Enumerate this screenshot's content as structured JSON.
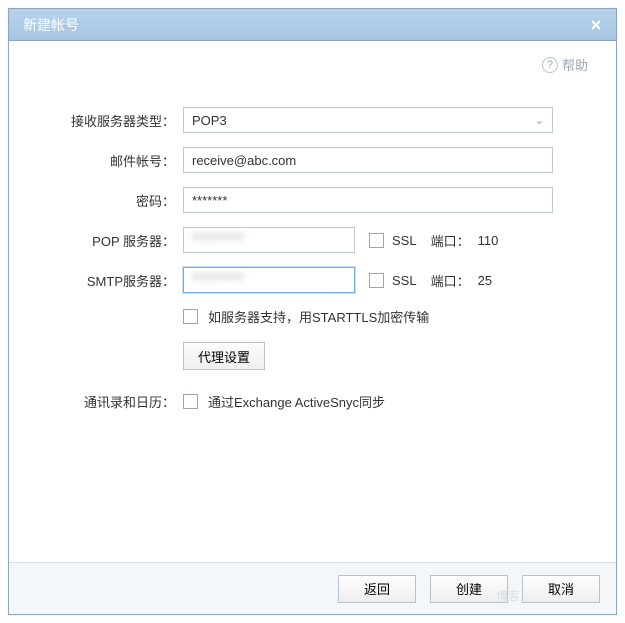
{
  "title": "新建帐号",
  "help": "帮助",
  "labels": {
    "server_type": "接收服务器类型：",
    "account": "邮件帐号：",
    "password": "密码：",
    "pop": "POP 服务器：",
    "smtp": "SMTP服务器：",
    "ssl": "SSL",
    "port": "端口：",
    "starttls": "如服务器支持，用STARTTLS加密传输",
    "proxy": "代理设置",
    "contacts": "通讯录和日历：",
    "eas": "通过Exchange ActiveSnyc同步"
  },
  "values": {
    "server_type": "POP3",
    "account": "receive@abc.com",
    "password": "*******",
    "pop_server": "",
    "smtp_server": "",
    "pop_port": "110",
    "smtp_port": "25"
  },
  "buttons": {
    "back": "返回",
    "create": "创建",
    "cancel": "取消"
  },
  "watermark": "博客"
}
